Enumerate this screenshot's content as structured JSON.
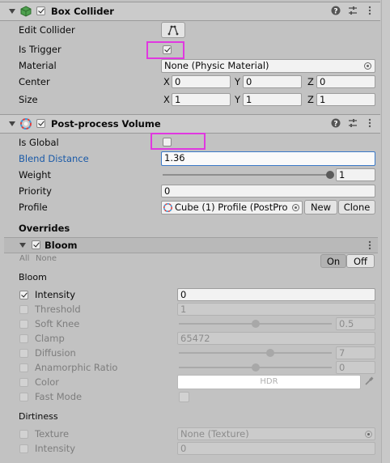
{
  "box_collider": {
    "title": "Box Collider",
    "edit_collider_label": "Edit Collider",
    "is_trigger_label": "Is Trigger",
    "material_label": "Material",
    "material_value": "None (Physic Material)",
    "center_label": "Center",
    "center": {
      "x": "0",
      "y": "0",
      "z": "0"
    },
    "size_label": "Size",
    "size": {
      "x": "1",
      "y": "1",
      "z": "1"
    },
    "axes": {
      "x": "X",
      "y": "Y",
      "z": "Z"
    }
  },
  "post_process": {
    "title": "Post-process Volume",
    "is_global_label": "Is Global",
    "blend_distance_label": "Blend Distance",
    "blend_distance_value": "1.36",
    "weight_label": "Weight",
    "weight_value": "1",
    "priority_label": "Priority",
    "priority_value": "0",
    "profile_label": "Profile",
    "profile_value": "Cube (1) Profile (PostPro",
    "new_label": "New",
    "clone_label": "Clone",
    "overrides_label": "Overrides"
  },
  "bloom": {
    "title": "Bloom",
    "all_label": "All",
    "none_label": "None",
    "on_label": "On",
    "off_label": "Off",
    "section_bloom": "Bloom",
    "intensity_label": "Intensity",
    "intensity_value": "0",
    "threshold_label": "Threshold",
    "threshold_value": "1",
    "soft_knee_label": "Soft Knee",
    "soft_knee_value": "0.5",
    "clamp_label": "Clamp",
    "clamp_value": "65472",
    "diffusion_label": "Diffusion",
    "diffusion_value": "7",
    "anamorphic_label": "Anamorphic Ratio",
    "anamorphic_value": "0",
    "color_label": "Color",
    "color_value": "HDR",
    "fast_mode_label": "Fast Mode",
    "section_dirtiness": "Dirtiness",
    "texture_label": "Texture",
    "texture_value": "None (Texture)",
    "dirt_intensity_label": "Intensity",
    "dirt_intensity_value": "0"
  },
  "sliders": {
    "weight_fraction": 1.0,
    "soft_knee_fraction": 0.5,
    "diffusion_fraction": 0.6,
    "anamorphic_fraction": 0.5
  },
  "colors": {
    "highlight": "#e038e0",
    "accent_blue": "#1a5aa8",
    "collider_icon": "#4fa04f"
  }
}
